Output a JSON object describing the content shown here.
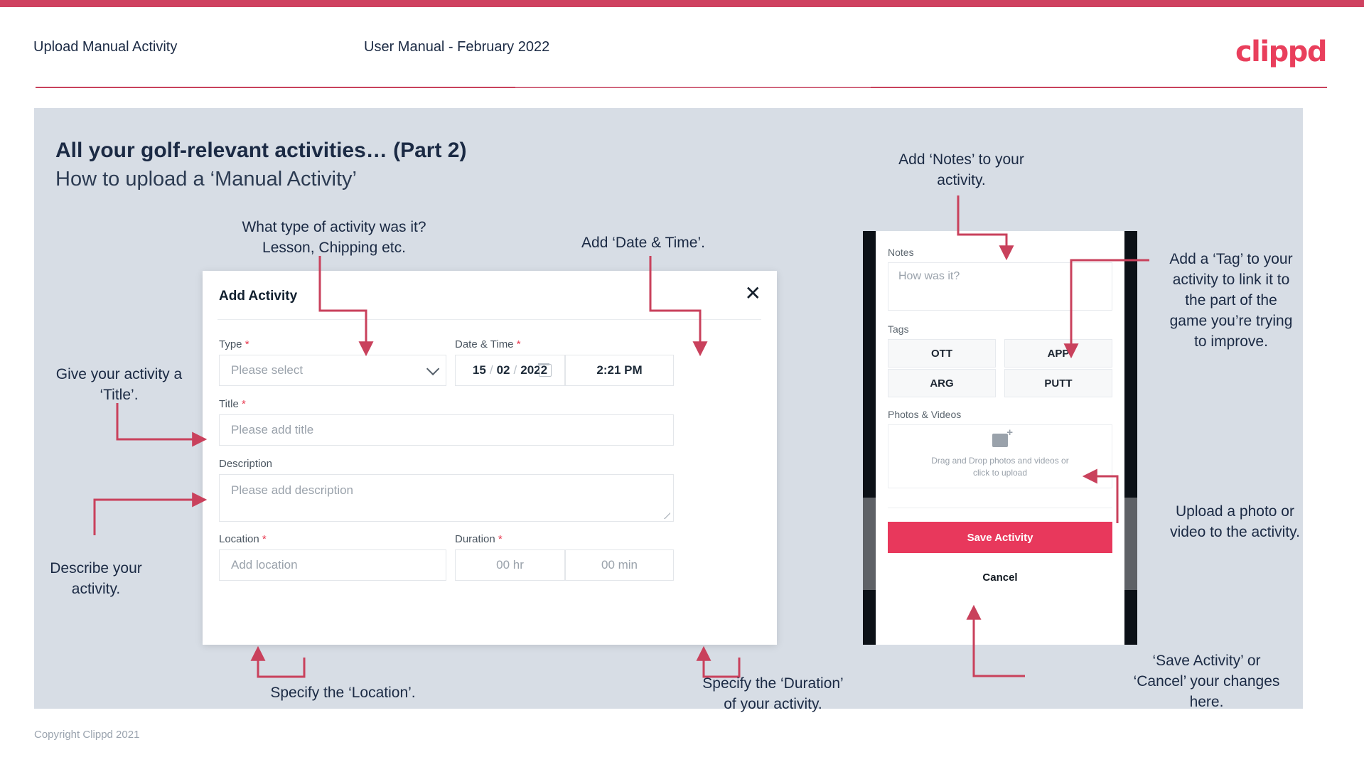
{
  "header": {
    "left_title": "Upload Manual Activity",
    "center_title": "User Manual - February 2022",
    "logo": "clippd"
  },
  "slide": {
    "title_line1": "All your golf-relevant activities… (Part 2)",
    "title_line2": "How to upload a ‘Manual Activity’"
  },
  "footer": {
    "copyright": "Copyright Clippd 2021"
  },
  "dialog": {
    "title": "Add Activity",
    "close_icon": "close-icon",
    "fields": {
      "type": {
        "label": "Type",
        "required": "*",
        "placeholder": "Please select"
      },
      "datetime": {
        "label": "Date & Time",
        "required": "*",
        "day": "15",
        "month": "02",
        "year": "2022",
        "separator": "/",
        "time": "2:21 PM"
      },
      "title": {
        "label": "Title",
        "required": "*",
        "placeholder": "Please add title"
      },
      "description": {
        "label": "Description",
        "required": "",
        "placeholder": "Please add description"
      },
      "location": {
        "label": "Location",
        "required": "*",
        "placeholder": "Add location"
      },
      "duration": {
        "label": "Duration",
        "required": "*",
        "hours_placeholder": "00 hr",
        "minutes_placeholder": "00 min"
      }
    }
  },
  "phone": {
    "notes": {
      "label": "Notes",
      "placeholder": "How was it?"
    },
    "tags": {
      "label": "Tags",
      "items": [
        "OTT",
        "APP",
        "ARG",
        "PUTT"
      ]
    },
    "photos": {
      "label": "Photos & Videos",
      "drop_line1": "Drag and Drop photos and videos or",
      "drop_line2": "click to upload",
      "icon": "image-add-icon"
    },
    "save_label": "Save Activity",
    "cancel_label": "Cancel"
  },
  "annotations": {
    "type": "What type of activity was it?\nLesson, Chipping etc.",
    "datetime": "Add ‘Date & Time’.",
    "title": "Give your activity a\n‘Title’.",
    "description": "Describe your\nactivity.",
    "location": "Specify the ‘Location’.",
    "duration": "Specify the ‘Duration’\nof your activity.",
    "notes": "Add ‘Notes’ to your\nactivity.",
    "tags": "Add a ‘Tag’ to your\nactivity to link it to\nthe part of the\ngame you’re trying\nto improve.",
    "photos": "Upload a photo or\nvideo to the activity.",
    "save": "‘Save Activity’ or\n‘Cancel’ your changes\nhere."
  },
  "colors": {
    "brand_red": "#e93f5c",
    "accent_bar": "#cf4260",
    "slide_bg": "#d7dde5",
    "arrow": "#c9415c",
    "text_dark": "#1b2a44",
    "save_btn": "#e8385c"
  }
}
